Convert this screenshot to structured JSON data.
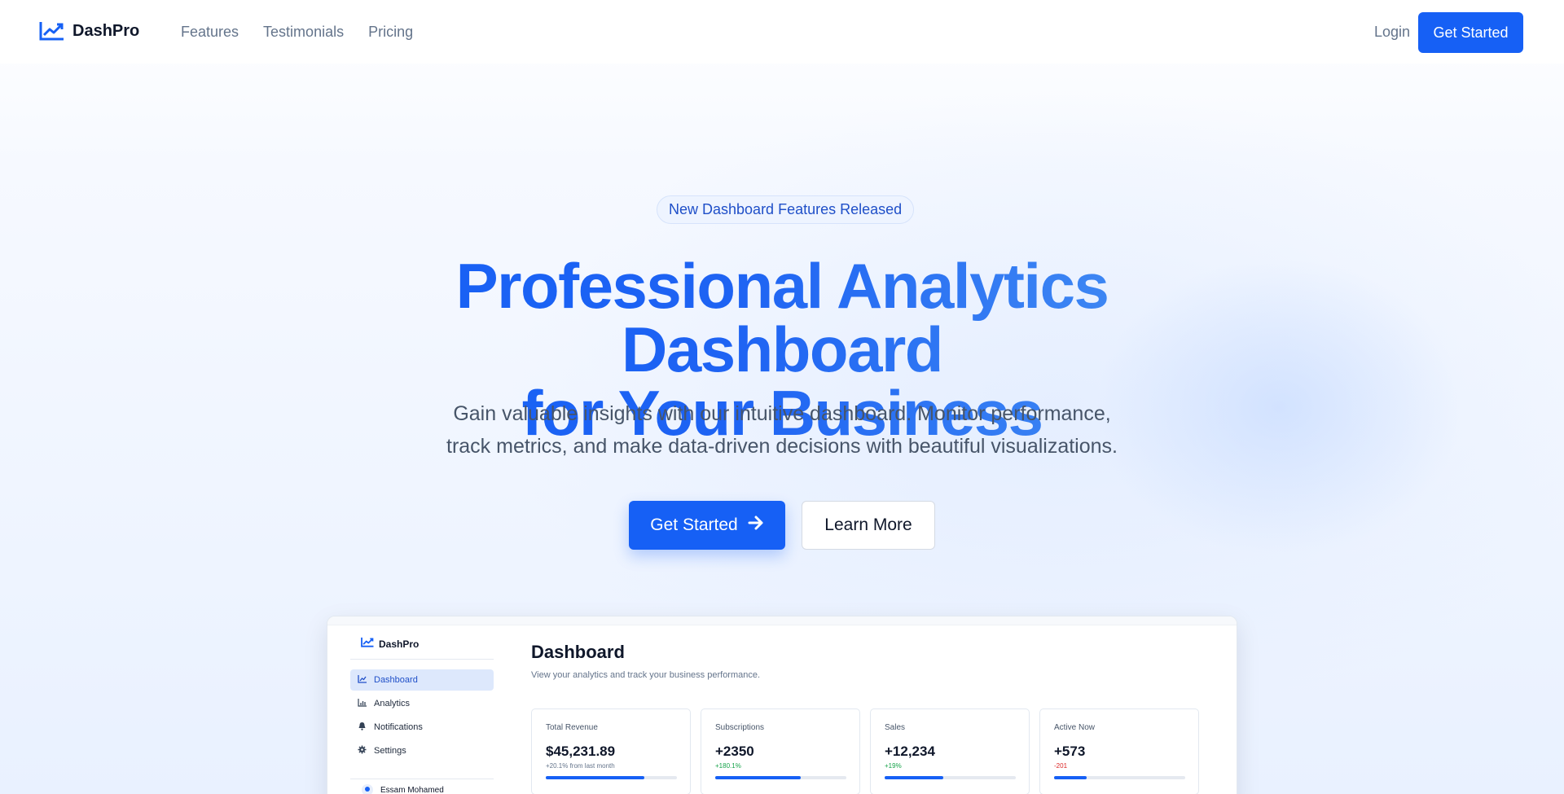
{
  "nav": {
    "brand": "DashPro",
    "links": [
      "Features",
      "Testimonials",
      "Pricing"
    ],
    "login": "Login",
    "cta": "Get Started"
  },
  "hero": {
    "badge": "New Dashboard Features Released",
    "title_line1": "Professional Analytics Dashboard",
    "title_line2": "for Your Business",
    "subtitle_line1": "Gain valuable insights with our intuitive dashboard. Monitor performance,",
    "subtitle_line2": "track metrics, and make data-driven decisions with beautiful visualizations.",
    "primary_button": "Get Started",
    "primary_icon": "arrow-right-icon",
    "secondary_button": "Learn More"
  },
  "preview": {
    "brand": "DashPro",
    "sidebar": [
      {
        "label": "Dashboard",
        "icon": "chart-line-icon",
        "active": true
      },
      {
        "label": "Analytics",
        "icon": "bar-chart-icon",
        "active": false
      },
      {
        "label": "Notifications",
        "icon": "bell-icon",
        "active": false
      },
      {
        "label": "Settings",
        "icon": "gear-icon",
        "active": false
      }
    ],
    "user_name": "Essam Mohamed",
    "title": "Dashboard",
    "subtitle": "View your analytics and track your business performance.",
    "cards": [
      {
        "label": "Total Revenue",
        "value": "$45,231.89",
        "change": "+20.1% from last month",
        "change_color": "#64748b",
        "progress": 0.75
      },
      {
        "label": "Subscriptions",
        "value": "+2350",
        "change": "+180.1%",
        "change_color": "#16a34a",
        "progress": 0.65
      },
      {
        "label": "Sales",
        "value": "+12,234",
        "change": "+19%",
        "change_color": "#16a34a",
        "progress": 0.45
      },
      {
        "label": "Active Now",
        "value": "+573",
        "change": "-201",
        "change_color": "#dc2626",
        "progress": 0.25
      }
    ]
  },
  "colors": {
    "primary": "#1660f5",
    "gradient_end": "#4a95f3",
    "text_muted": "#64748b"
  }
}
